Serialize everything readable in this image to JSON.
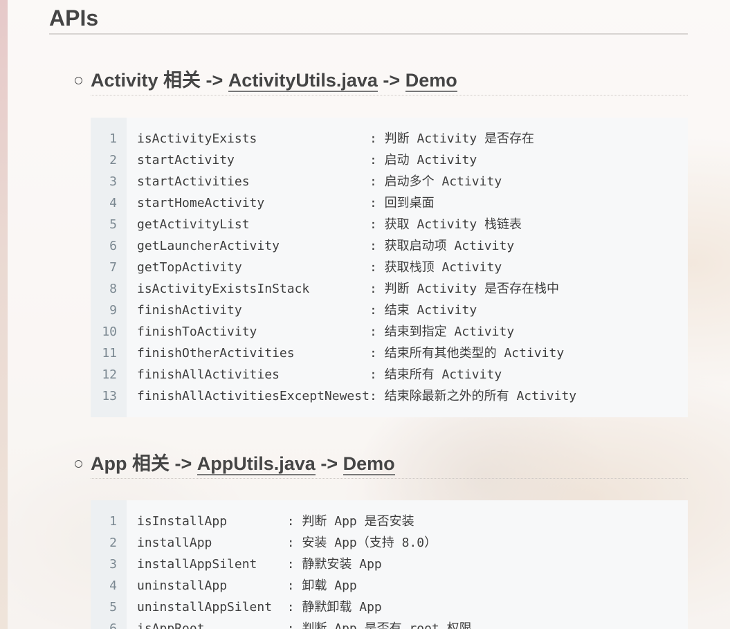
{
  "heading": "APIs",
  "sections": [
    {
      "title_prefix": "Activity 相关 ->",
      "link1": "ActivityUtils.java",
      "arrow": "->",
      "link2": "Demo",
      "lines": [
        "isActivityExists               : 判断 Activity 是否存在",
        "startActivity                  : 启动 Activity",
        "startActivities                : 启动多个 Activity",
        "startHomeActivity              : 回到桌面",
        "getActivityList                : 获取 Activity 栈链表",
        "getLauncherActivity            : 获取启动项 Activity",
        "getTopActivity                 : 获取栈顶 Activity",
        "isActivityExistsInStack        : 判断 Activity 是否存在栈中",
        "finishActivity                 : 结束 Activity",
        "finishToActivity               : 结束到指定 Activity",
        "finishOtherActivities          : 结束所有其他类型的 Activity",
        "finishAllActivities            : 结束所有 Activity",
        "finishAllActivitiesExceptNewest: 结束除最新之外的所有 Activity"
      ]
    },
    {
      "title_prefix": "App 相关 ->",
      "link1": "AppUtils.java",
      "arrow": "->",
      "link2": "Demo",
      "lines": [
        "isInstallApp        : 判断 App 是否安装",
        "installApp          : 安装 App（支持 8.0）",
        "installAppSilent    : 静默安装 App",
        "uninstallApp        : 卸载 App",
        "uninstallAppSilent  : 静默卸载 App",
        "isAppRoot           : 判断 App 是否有 root 权限"
      ]
    }
  ]
}
